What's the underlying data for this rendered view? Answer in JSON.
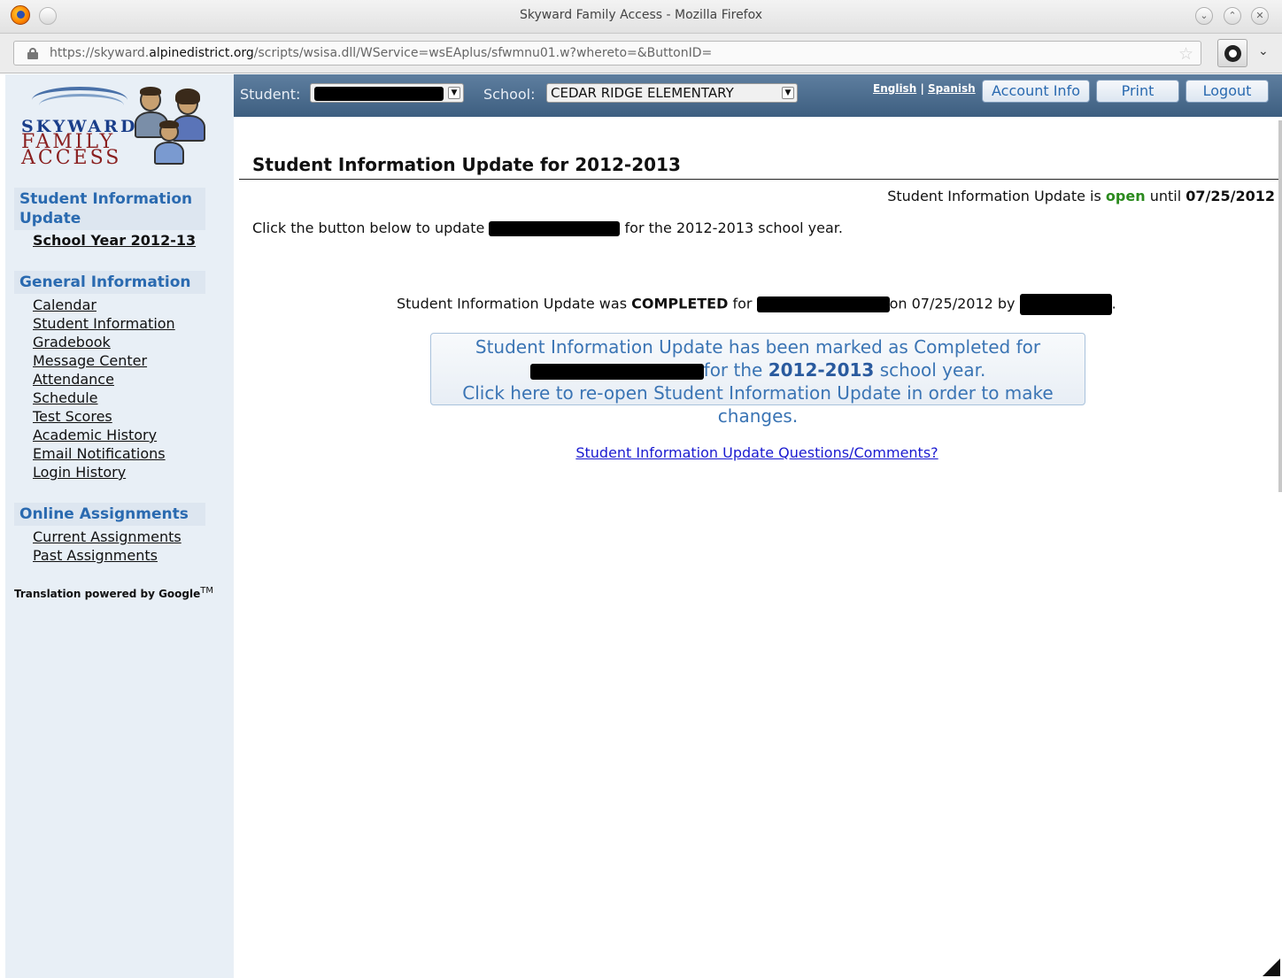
{
  "window": {
    "title": "Skyward Family Access - Mozilla Firefox",
    "url_prefix": "https://skyward.",
    "url_domain": "alpinedistrict.org",
    "url_path": "/scripts/wsisa.dll/WService=wsEAplus/sfwmnu01.w?whereto=&ButtonID="
  },
  "logo": {
    "line1": "SKYWARD",
    "line2": "FAMILY",
    "line3": "ACCESS"
  },
  "sidebar": {
    "sections": [
      {
        "title": "Student Information Update",
        "items": [
          "School Year 2012-13"
        ]
      },
      {
        "title": "General Information",
        "items": [
          "Calendar",
          "Student Information",
          "Gradebook",
          "Message Center",
          "Attendance",
          "Schedule",
          "Test Scores",
          "Academic History",
          "Email Notifications",
          "Login History"
        ]
      },
      {
        "title": "Online Assignments",
        "items": [
          "Current Assignments",
          "Past Assignments"
        ]
      }
    ],
    "translation": "Translation powered by Google",
    "translation_tm": "TM"
  },
  "topbar": {
    "student_label": "Student:",
    "school_label": "School:",
    "school_value": "CEDAR RIDGE ELEMENTARY",
    "lang_english": "English",
    "lang_sep": "|",
    "lang_spanish": "Spanish",
    "account_info": "Account Info",
    "print": "Print",
    "logout": "Logout"
  },
  "main": {
    "title": "Student Information Update for 2012-2013",
    "status_prefix": "Student Information Update is",
    "status_open": "open",
    "status_until": "until",
    "status_date": "07/25/2012",
    "intro_prefix": "Click the button below to update",
    "intro_suffix": "for the 2012-2013 school year.",
    "completed_prefix": "Student Information Update was",
    "completed_word": "COMPLETED",
    "completed_for": "for",
    "completed_on": "on 07/25/2012 by",
    "completed_end": ".",
    "reopen_line1": "Student Information Update has been marked as Completed for",
    "reopen_line2_pre": "for the",
    "reopen_line2_year": "2012-2013",
    "reopen_line2_post": "school year.",
    "reopen_line3": "Click here to re-open Student Information Update in order to make changes.",
    "questions_link": "Student Information Update Questions/Comments?"
  }
}
